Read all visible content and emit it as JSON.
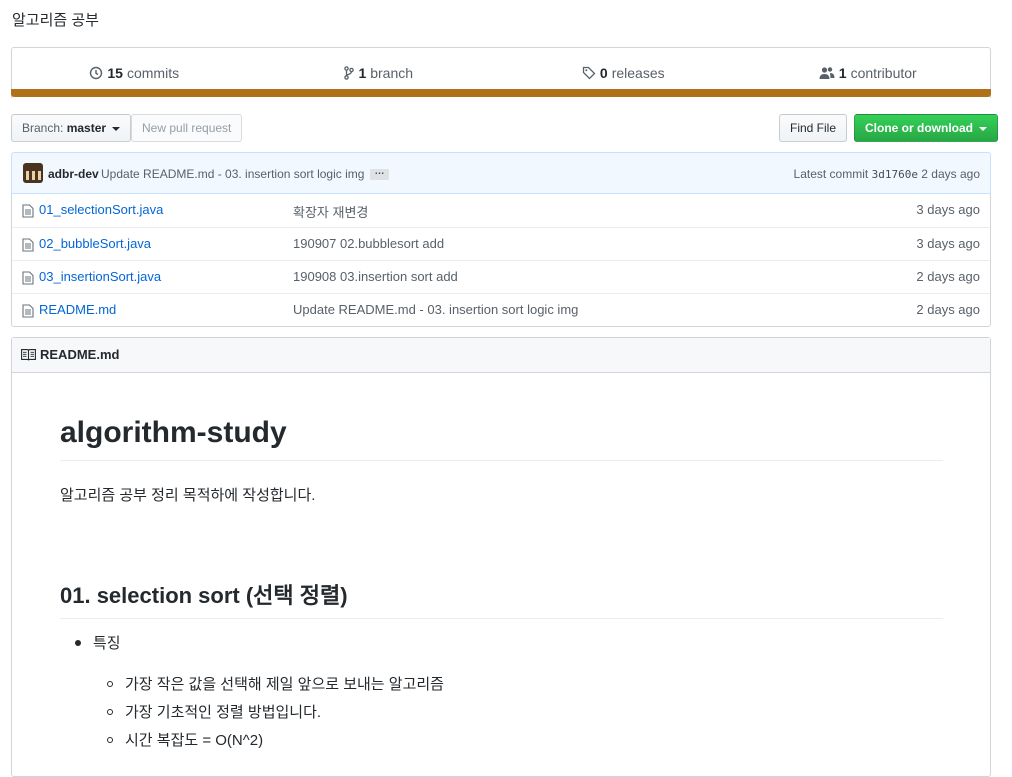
{
  "repo": {
    "description": "알고리즘 공부"
  },
  "summary": {
    "commits_count": "15",
    "commits_label": "commits",
    "branches_count": "1",
    "branches_label": "branch",
    "releases_count": "0",
    "releases_label": "releases",
    "contributors_count": "1",
    "contributors_label": "contributor",
    "language_color": "#b07219"
  },
  "toolbar": {
    "branch_prefix": "Branch:",
    "branch_name": "master",
    "new_pull_request": "New pull request",
    "find_file": "Find File",
    "clone_download": "Clone or download"
  },
  "commit": {
    "author": "adbr-dev",
    "message": "Update README.md - 03. insertion sort logic img",
    "ellipsis": "…",
    "latest_label": "Latest commit",
    "sha": "3d1760e",
    "age": "2 days ago"
  },
  "files": [
    {
      "name": "01_selectionSort.java",
      "message": "확장자 재변경",
      "age": "3 days ago"
    },
    {
      "name": "02_bubbleSort.java",
      "message": "190907 02.bubblesort add",
      "age": "3 days ago"
    },
    {
      "name": "03_insertionSort.java",
      "message": "190908 03.insertion sort add",
      "age": "2 days ago"
    },
    {
      "name": "README.md",
      "message": "Update README.md - 03. insertion sort logic img",
      "age": "2 days ago"
    }
  ],
  "readme": {
    "filename": "README.md",
    "h1": "algorithm-study",
    "intro": "알고리즘 공부 정리 목적하에 작성합니다.",
    "h2": "01. selection sort (선택 정렬)",
    "feature_label": "특징",
    "features": [
      "가장 작은 값을 선택해 제일 앞으로 보내는 알고리즘",
      "가장 기초적인 정렬 방법입니다.",
      "시간 복잡도 = O(N^2)"
    ]
  }
}
